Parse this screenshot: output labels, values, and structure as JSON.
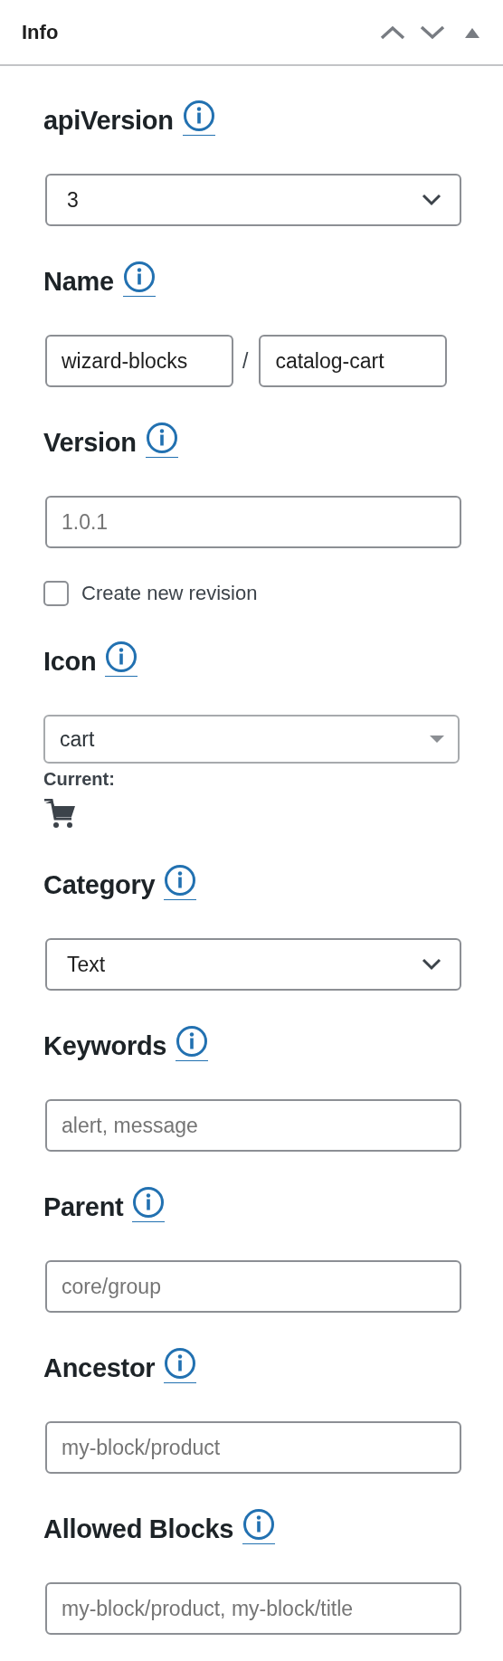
{
  "panel": {
    "title": "Info"
  },
  "fields": [
    {
      "kind": "select",
      "label": "apiVersion",
      "value": "3"
    },
    {
      "kind": "name",
      "label": "Name",
      "namespace": "wizard-blocks",
      "separator": "/",
      "slug": "catalog-cart"
    },
    {
      "kind": "text",
      "label": "Version",
      "placeholder": "1.0.1",
      "checkbox": {
        "label": "Create new revision",
        "checked": false
      }
    },
    {
      "kind": "icon",
      "label": "Icon",
      "value": "cart",
      "current_label": "Current:"
    },
    {
      "kind": "select",
      "label": "Category",
      "value": "Text"
    },
    {
      "kind": "text",
      "label": "Keywords",
      "placeholder": "alert, message"
    },
    {
      "kind": "text",
      "label": "Parent",
      "placeholder": "core/group"
    },
    {
      "kind": "text",
      "label": "Ancestor",
      "placeholder": "my-block/product"
    },
    {
      "kind": "text",
      "label": "Allowed Blocks",
      "placeholder": "my-block/product, my-block/title"
    }
  ]
}
